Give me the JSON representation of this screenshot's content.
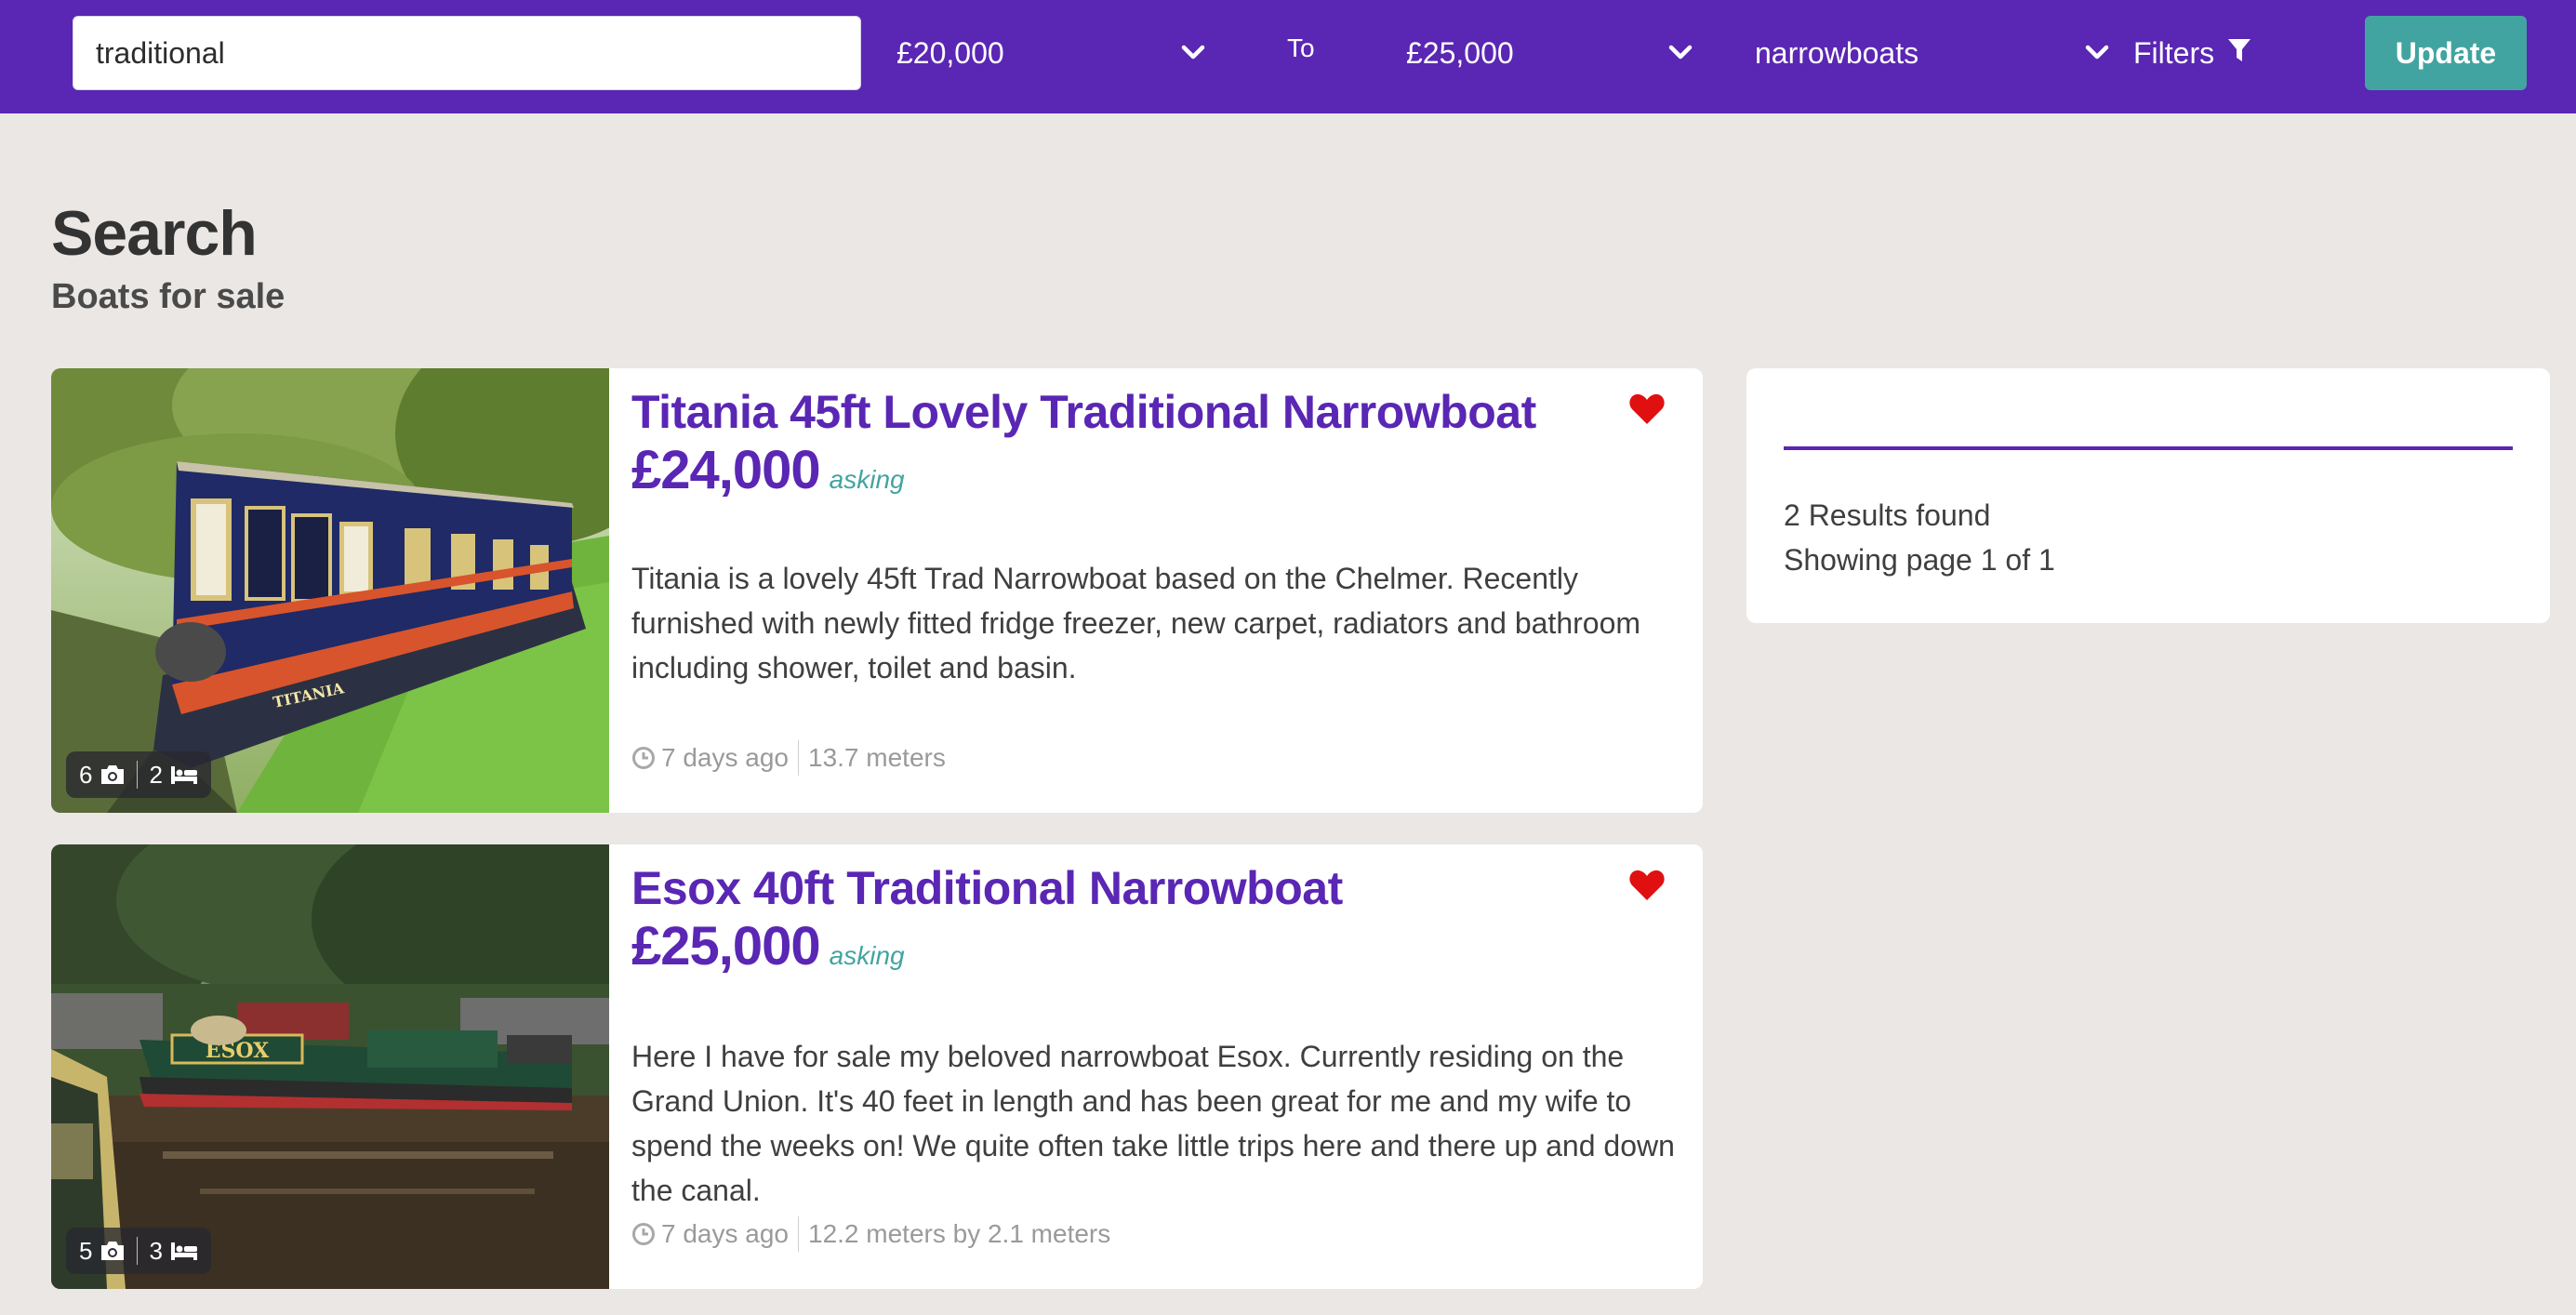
{
  "search": {
    "value": "traditional"
  },
  "filters": {
    "price_min": "£20,000",
    "to_label": "To",
    "price_max": "£25,000",
    "boat_type": "narrowboats",
    "filters_label": "Filters",
    "update_label": "Update"
  },
  "page": {
    "title": "Search",
    "subtitle": "Boats for sale"
  },
  "listings": [
    {
      "title": "Titania 45ft Lovely Traditional Narrowboat",
      "price": "£24,000",
      "price_note": "asking",
      "description": "Titania is a lovely 45ft Trad Narrowboat based on the Chelmer. Recently furnished with newly fitted fridge freezer, new carpet, radiators and bathroom including shower, toilet and basin.",
      "posted": "7 days ago",
      "size": "13.7 meters",
      "photo_count": "6",
      "berths": "2",
      "boat_name_on_hull": "TITANIA"
    },
    {
      "title": "Esox 40ft Traditional Narrowboat",
      "price": "£25,000",
      "price_note": "asking",
      "description": "Here I have for sale my beloved narrowboat Esox. Currently residing on the Grand Union. It's 40 feet in length and has been great for me and my wife to spend the weeks on! We quite often take little trips here and there up and down the canal.",
      "posted": "7 days ago",
      "size": "12.2 meters by 2.1 meters",
      "photo_count": "5",
      "berths": "3",
      "boat_name_on_hull": "ESOX"
    }
  ],
  "results": {
    "count_text": "2 Results found",
    "page_text": "Showing page 1 of 1"
  },
  "icons": {
    "chevron": "chevron-down-icon",
    "filter": "filter-icon",
    "heart": "heart-icon",
    "camera": "camera-icon",
    "bed": "bed-icon",
    "clock": "clock-icon"
  },
  "colors": {
    "brand": "#5a26b4",
    "accent": "#42a4a0",
    "heart": "#e01010",
    "background": "#ebe7e5"
  }
}
